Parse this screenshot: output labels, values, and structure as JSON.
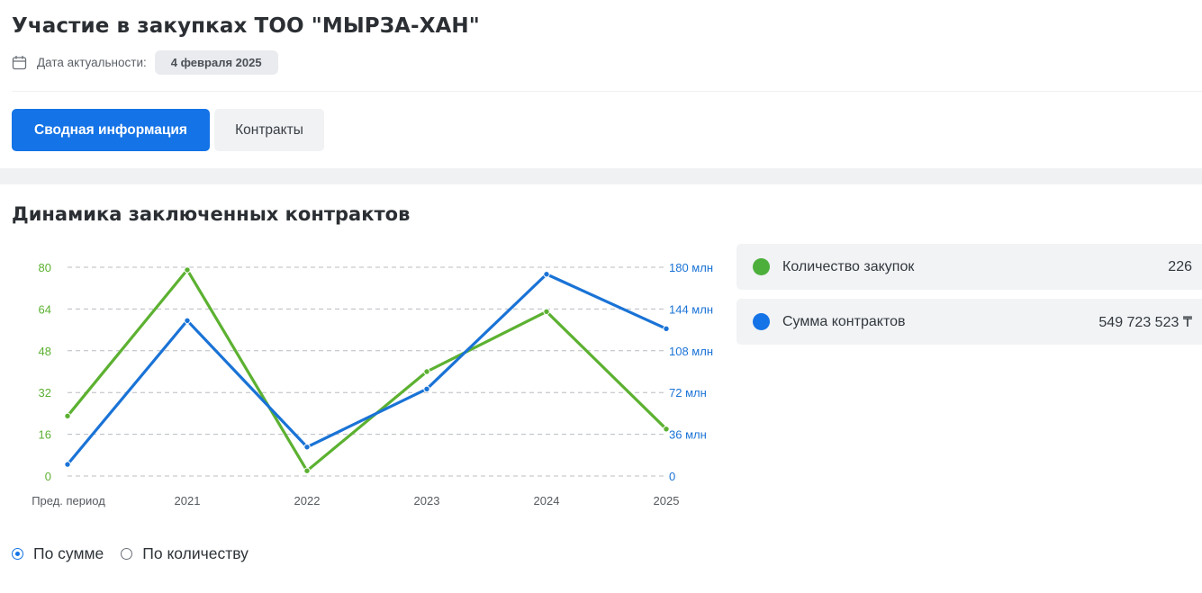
{
  "header": {
    "title": "Участие в закупках ТОО \"МЫРЗА-ХАН\"",
    "date_label": "Дата актуальности:",
    "date_value": "4 февраля 2025"
  },
  "tabs": [
    {
      "label": "Сводная информация",
      "active": true
    },
    {
      "label": "Контракты",
      "active": false
    }
  ],
  "section": {
    "title": "Динамика заключенных контрактов"
  },
  "legend": {
    "count": {
      "label": "Количество закупок",
      "value": "226",
      "color": "#4caf3c"
    },
    "sum": {
      "label": "Сумма контрактов",
      "value": "549 723 523 ₸",
      "color": "#1473e6"
    }
  },
  "radios": {
    "by_sum": "По сумме",
    "by_count": "По количеству",
    "selected": "by_sum"
  },
  "chart_data": {
    "type": "line",
    "x": [
      "Пред. период",
      "2021",
      "2022",
      "2023",
      "2024",
      "2025"
    ],
    "series": [
      {
        "name": "Количество закупок",
        "axis": "left",
        "color": "#5cb131",
        "values": [
          23,
          79,
          2,
          40,
          63,
          18
        ]
      },
      {
        "name": "Сумма контрактов",
        "axis": "right",
        "color": "#1a73d6",
        "values": [
          10,
          134,
          25,
          75,
          174,
          127
        ]
      }
    ],
    "left_axis": {
      "ticks": [
        "0",
        "16",
        "32",
        "48",
        "64",
        "80"
      ],
      "ylim": [
        0,
        80
      ]
    },
    "right_axis": {
      "ticks": [
        "0",
        "36 млн",
        "72 млн",
        "108 млн",
        "144 млн",
        "180 млн"
      ],
      "ylim": [
        0,
        180
      ],
      "unit": "млн"
    },
    "grid": "dashed horizontal"
  }
}
